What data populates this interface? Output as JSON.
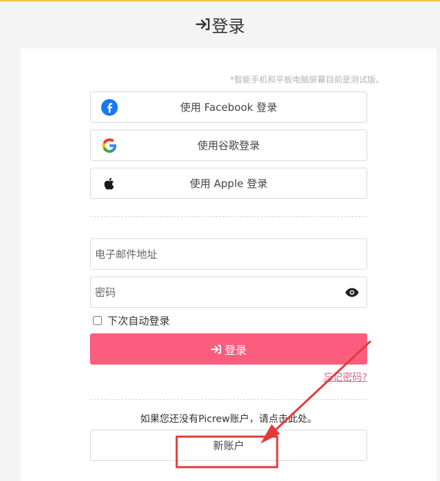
{
  "page": {
    "title": "登录",
    "note": "*智能手机和平板电脑屏幕目前是测试版。"
  },
  "sso": {
    "facebook": "使用 Facebook 登录",
    "google": "使用谷歌登录",
    "apple": "使用 Apple 登录"
  },
  "form": {
    "email_placeholder": "电子邮件地址",
    "password_placeholder": "密码",
    "remember_label": "下次自动登录",
    "login_label": "登录",
    "forgot_label": "忘记密码?"
  },
  "signup": {
    "hint": "如果您还没有Picrew账户，请点击此处。",
    "button_label": "新账户"
  },
  "colors": {
    "accent": "#fc5c7d",
    "top_bar": "#f3c13a",
    "annotation": "#e03c3c"
  }
}
